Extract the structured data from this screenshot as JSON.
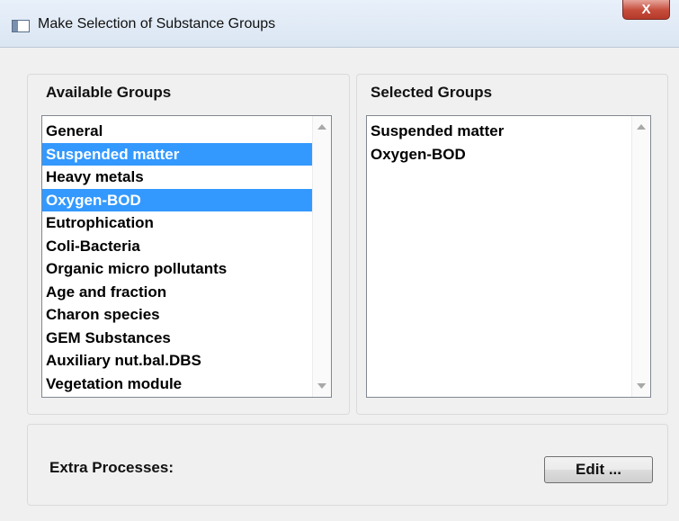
{
  "window": {
    "title": "Make Selection of Substance Groups",
    "close_label": "X"
  },
  "available": {
    "title": "Available Groups",
    "items": [
      {
        "label": "General",
        "selected": false
      },
      {
        "label": "Suspended matter",
        "selected": true
      },
      {
        "label": "Heavy metals",
        "selected": false
      },
      {
        "label": "Oxygen-BOD",
        "selected": true
      },
      {
        "label": "Eutrophication",
        "selected": false
      },
      {
        "label": "Coli-Bacteria",
        "selected": false
      },
      {
        "label": "Organic micro pollutants",
        "selected": false
      },
      {
        "label": "Age and fraction",
        "selected": false
      },
      {
        "label": "Charon species",
        "selected": false
      },
      {
        "label": "GEM Substances",
        "selected": false
      },
      {
        "label": "Auxiliary nut.bal.DBS",
        "selected": false
      },
      {
        "label": "Vegetation module",
        "selected": false
      }
    ]
  },
  "selected": {
    "title": "Selected Groups",
    "items": [
      {
        "label": "Suspended matter"
      },
      {
        "label": "Oxygen-BOD"
      }
    ]
  },
  "extra": {
    "label": "Extra Processes:",
    "edit_label": "Edit ..."
  },
  "colors": {
    "selection": "#3399ff",
    "close_button": "#c54b3a"
  }
}
